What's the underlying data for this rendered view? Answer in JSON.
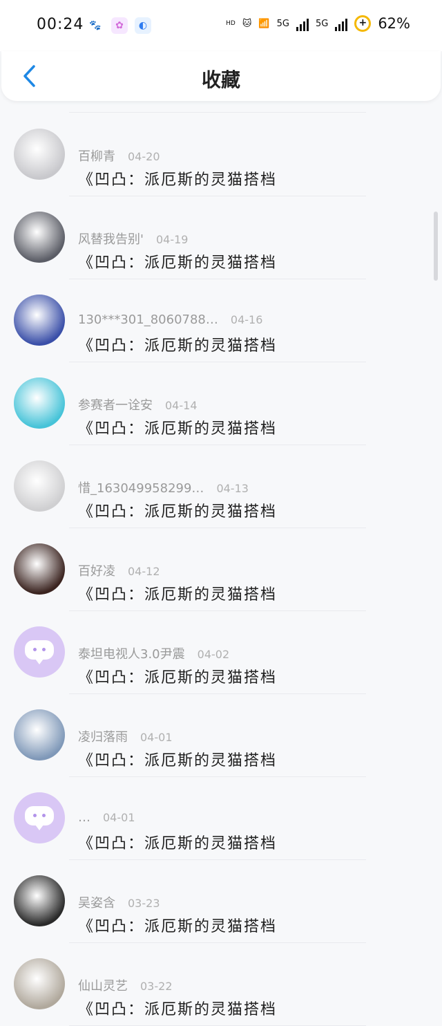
{
  "status_bar": {
    "time": "00:24",
    "hd_label": "HD",
    "net_5g_1": "5G",
    "net_5g_2": "5G",
    "battery_percent": "62%"
  },
  "nav": {
    "title": "收藏"
  },
  "items": [
    {
      "user": "百柳青",
      "date": "04-20",
      "book": "《凹凸：派厄斯的灵猫搭档",
      "avatar_color": "#c8c8cc"
    },
    {
      "user": "风替我告别'",
      "date": "04-19",
      "book": "《凹凸：派厄斯的灵猫搭档",
      "avatar_color": "#5b5d66"
    },
    {
      "user": "130***301_8060788…",
      "date": "04-16",
      "book": "《凹凸：派厄斯的灵猫搭档",
      "avatar_color": "#3a4fa8"
    },
    {
      "user": "参赛者一诠安",
      "date": "04-14",
      "book": "《凹凸：派厄斯的灵猫搭档",
      "avatar_color": "#46c3d8"
    },
    {
      "user": "惜_163049958299…",
      "date": "04-13",
      "book": "《凹凸：派厄斯的灵猫搭档",
      "avatar_color": "#cfcfd1"
    },
    {
      "user": "百好凌",
      "date": "04-12",
      "book": "《凹凸：派厄斯的灵猫搭档",
      "avatar_color": "#3b2420"
    },
    {
      "user": "泰坦电视人3.0尹震",
      "date": "04-02",
      "book": "《凹凸：派厄斯的灵猫搭档",
      "avatar_color": "default"
    },
    {
      "user": "凌归落雨",
      "date": "04-01",
      "book": "《凹凸：派厄斯的灵猫搭档",
      "avatar_color": "#7f98b8"
    },
    {
      "user": "…",
      "date": "04-01",
      "book": "《凹凸：派厄斯的灵猫搭档",
      "avatar_color": "default"
    },
    {
      "user": "吴姿含",
      "date": "03-23",
      "book": "《凹凸：派厄斯的灵猫搭档",
      "avatar_color": "#2a2a2a"
    },
    {
      "user": "仙山灵艺",
      "date": "03-22",
      "book": "《凹凸：派厄斯的灵猫搭档",
      "avatar_color": "#b0a89c"
    }
  ],
  "colors": {
    "accent": "#1e88e5",
    "default_avatar": "#d9c7f5"
  }
}
